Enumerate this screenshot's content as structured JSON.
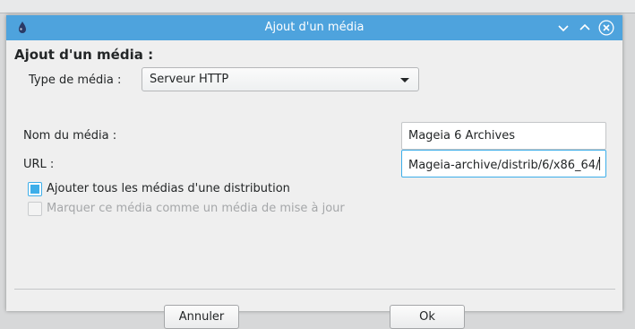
{
  "window": {
    "title": "Ajout d'un média"
  },
  "dialog": {
    "heading": "Ajout d'un média :",
    "type_label": "Type de média :",
    "type_value": "Serveur HTTP",
    "name_label": "Nom du média :",
    "name_value": "Mageia 6 Archives",
    "url_label": "URL :",
    "url_value": "Mageia-archive/distrib/6/x86_64/",
    "checkbox_distribution": {
      "label": "Ajouter tous les médias d'une distribution",
      "checked": true
    },
    "checkbox_update": {
      "label": "Marquer ce média comme un média de mise à jour",
      "checked": false,
      "disabled": true
    }
  },
  "buttons": {
    "cancel": "Annuler",
    "ok": "Ok"
  },
  "colors": {
    "titlebar": "#4ea3dd",
    "accent": "#3daee9"
  },
  "icons": [
    "mageia-app-icon",
    "minimize-icon",
    "maximize-icon",
    "close-icon",
    "dropdown-arrow-icon",
    "checkbox-icon"
  ]
}
